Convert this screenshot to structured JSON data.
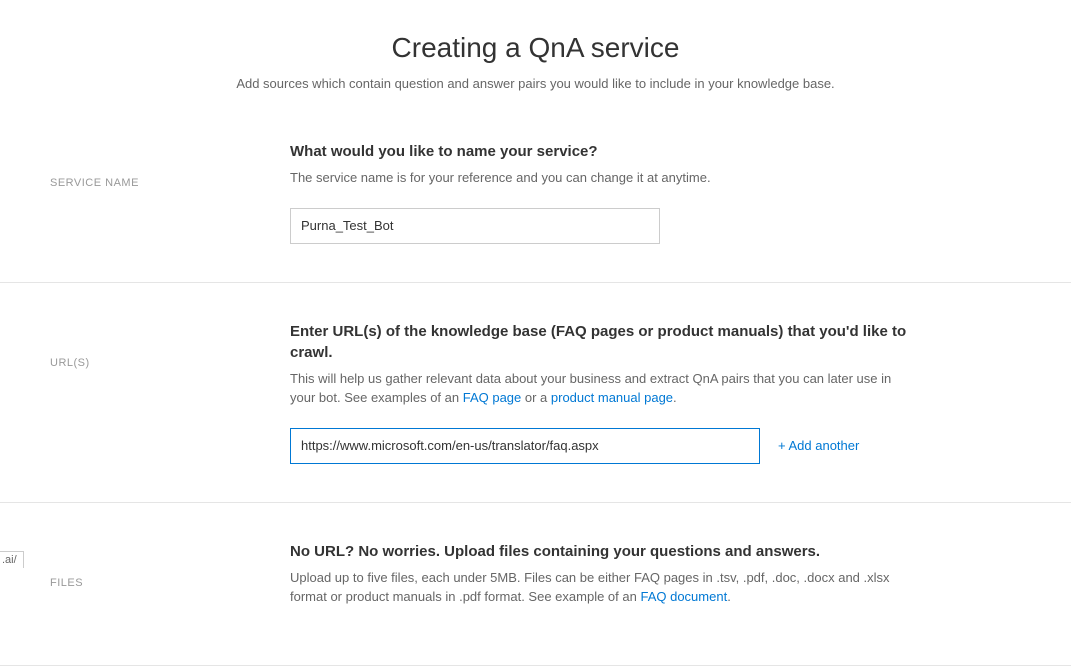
{
  "header": {
    "title": "Creating a QnA service",
    "subtitle": "Add sources which contain question and answer pairs you would like to include in your knowledge base."
  },
  "sections": {
    "serviceName": {
      "label": "SERVICE NAME",
      "heading": "What would you like to name your service?",
      "description": "The service name is for your reference and you can change it at anytime.",
      "inputValue": "Purna_Test_Bot"
    },
    "urls": {
      "label": "URL(S)",
      "heading": "Enter URL(s) of the knowledge base (FAQ pages or product manuals) that you'd like to crawl.",
      "descriptionPart1": "This will help us gather relevant data about your business and extract QnA pairs that you can later use in your bot. See examples of an ",
      "faqLink": "FAQ page",
      "descriptionPart2": " or a ",
      "manualLink": "product manual page",
      "descriptionPart3": ".",
      "inputValue": "https://www.microsoft.com/en-us/translator/faq.aspx",
      "addAnother": "+ Add another"
    },
    "files": {
      "label": "FILES",
      "heading": "No URL? No worries. Upload files containing your questions and answers.",
      "descriptionPart1": "Upload up to five files, each under 5MB. Files can be either FAQ pages in .tsv, .pdf, .doc, .docx and .xlsx format or product manuals in .pdf format. See example of an ",
      "faqDocLink": "FAQ document",
      "descriptionPart2": "."
    }
  },
  "statusBar": ".ai/"
}
